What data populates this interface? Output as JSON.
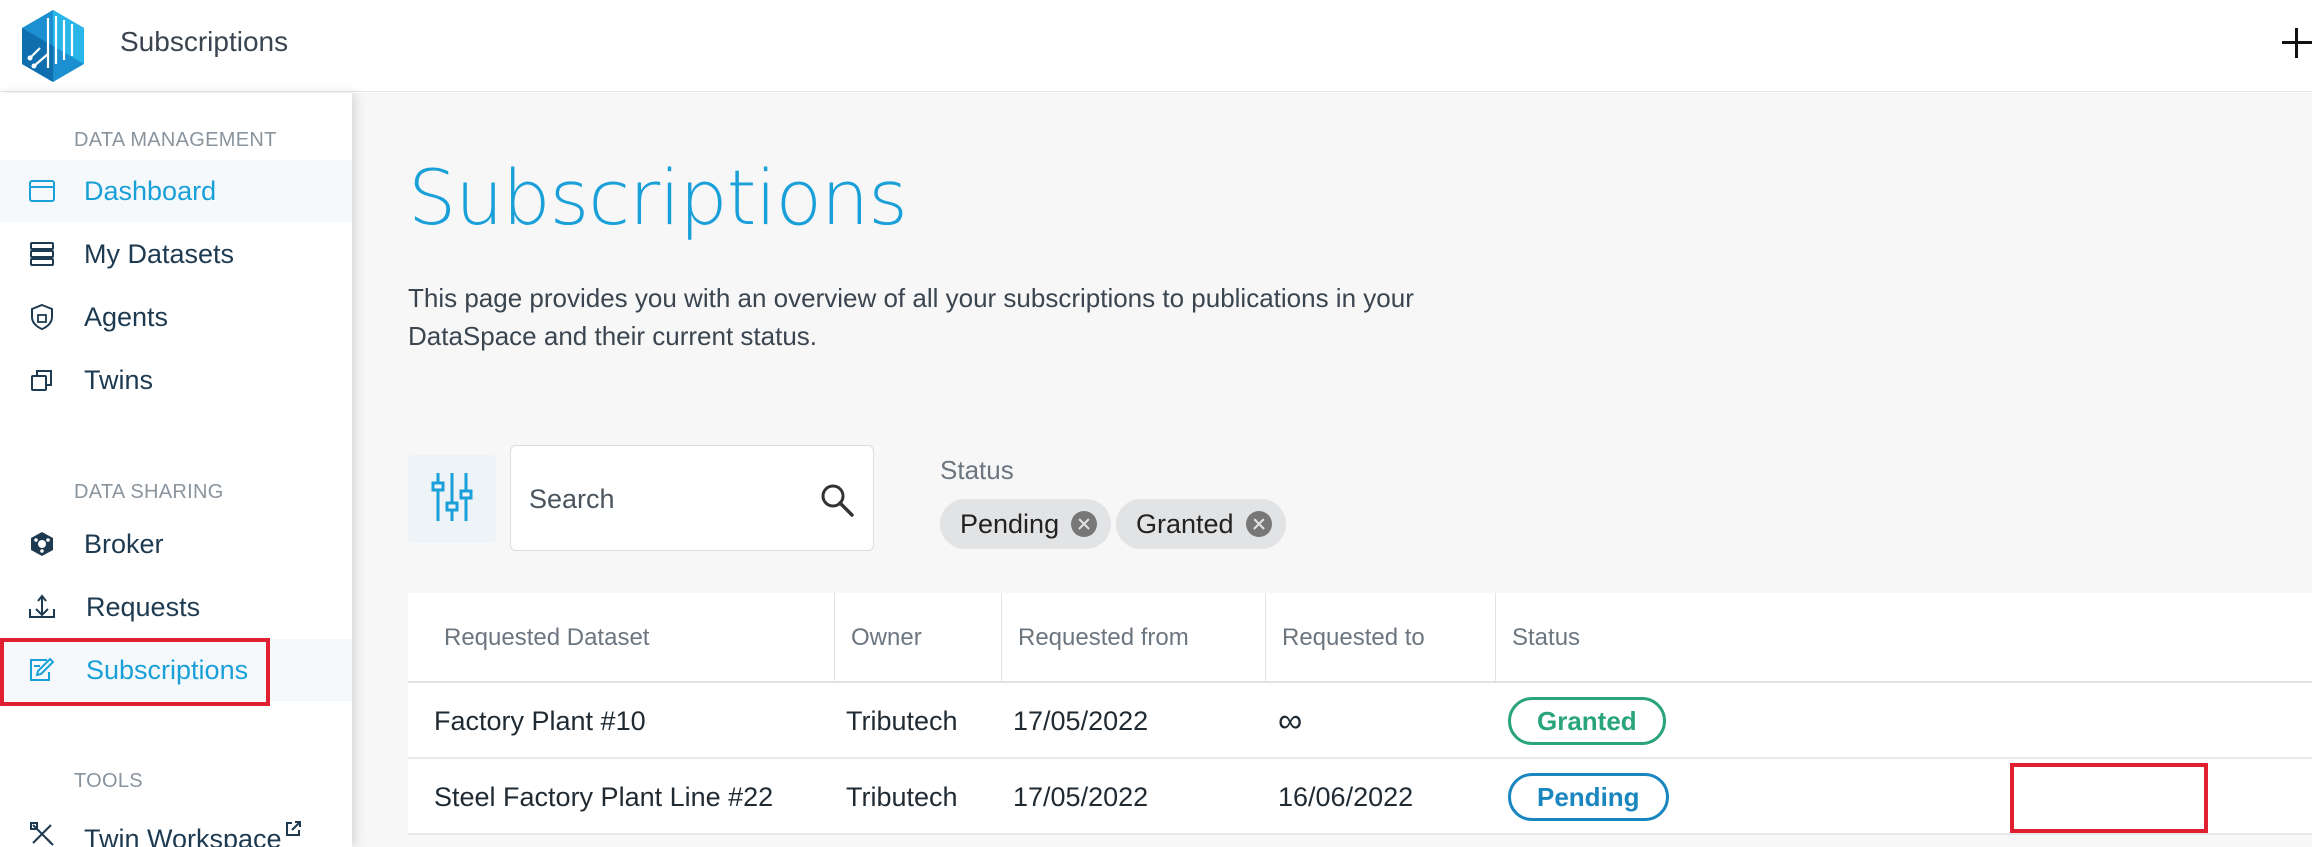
{
  "header": {
    "app_title": "Subscriptions",
    "logo_icon": "tributech-logo",
    "add_icon": "plus-icon"
  },
  "sidebar": {
    "sections": [
      {
        "label": "DATA MANAGEMENT"
      },
      {
        "label": "DATA SHARING"
      },
      {
        "label": "TOOLS"
      }
    ],
    "items": [
      {
        "label": "Dashboard",
        "icon": "dashboard-icon",
        "active": true
      },
      {
        "label": "My Datasets",
        "icon": "datasets-icon"
      },
      {
        "label": "Agents",
        "icon": "agents-shield-icon"
      },
      {
        "label": "Twins",
        "icon": "twins-icon"
      },
      {
        "label": "Broker",
        "icon": "broker-icon"
      },
      {
        "label": "Requests",
        "icon": "requests-icon"
      },
      {
        "label": "Subscriptions",
        "icon": "subscriptions-icon",
        "active": true
      },
      {
        "label": "Twin Workspace",
        "icon": "twin-workspace-icon",
        "external": true
      }
    ]
  },
  "main": {
    "title": "Subscriptions",
    "description": "This page provides you with an overview of all your subscriptions to publications in your DataSpace and their current status.",
    "search": {
      "placeholder": "Search",
      "value": ""
    },
    "status_filter": {
      "label": "Status",
      "chips": [
        "Pending",
        "Granted"
      ]
    },
    "table": {
      "columns": [
        "Requested Dataset",
        "Owner",
        "Requested from",
        "Requested to",
        "Status"
      ],
      "rows": [
        {
          "dataset": "Factory Plant #10",
          "owner": "Tributech",
          "from": "17/05/2022",
          "to": "∞",
          "status": "Granted"
        },
        {
          "dataset": "Steel Factory Plant Line #22",
          "owner": "Tributech",
          "from": "17/05/2022",
          "to": "16/06/2022",
          "status": "Pending"
        }
      ]
    }
  },
  "colors": {
    "accent": "#1aa0d8",
    "granted": "#2aa57a",
    "pending": "#1a86c0",
    "highlight": "#e02030"
  }
}
